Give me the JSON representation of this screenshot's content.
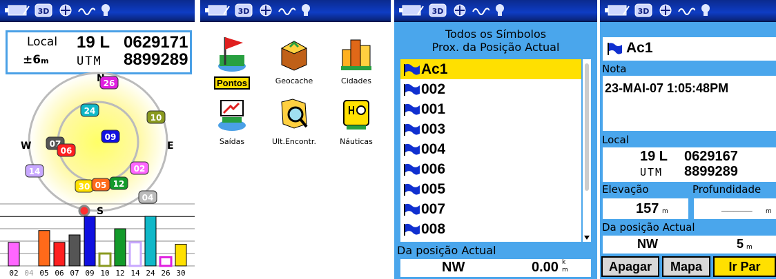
{
  "gps": {
    "location_label": "Local",
    "accuracy_value": "±6",
    "accuracy_unit": "m",
    "utm_label": "UTM",
    "zone": "19 L",
    "easting": "0629171",
    "northing": "8899289",
    "compass": {
      "n": "N",
      "s": "S",
      "e": "E",
      "w": "W"
    },
    "satellites_sky": [
      "26",
      "24",
      "10",
      "09",
      "07",
      "06",
      "14",
      "02",
      "30",
      "05",
      "12",
      "04"
    ],
    "signal_bars": [
      {
        "id": "02",
        "level": 0.38,
        "color": "#ff66ff",
        "filled": true
      },
      {
        "id": "04",
        "level": 0.0,
        "color": "#bbbbbb",
        "filled": false
      },
      {
        "id": "05",
        "level": 0.57,
        "color": "#ff6a1a",
        "filled": true
      },
      {
        "id": "06",
        "level": 0.38,
        "color": "#ff2020",
        "filled": true
      },
      {
        "id": "07",
        "level": 0.5,
        "color": "#555555",
        "filled": true
      },
      {
        "id": "09",
        "level": 0.8,
        "color": "#1010e0",
        "filled": true
      },
      {
        "id": "10",
        "level": 0.2,
        "color": "#8a9a20",
        "filled": false
      },
      {
        "id": "12",
        "level": 0.6,
        "color": "#139a2a",
        "filled": true
      },
      {
        "id": "14",
        "level": 0.38,
        "color": "#c8a8ff",
        "filled": false
      },
      {
        "id": "24",
        "level": 0.8,
        "color": "#10b8c8",
        "filled": true
      },
      {
        "id": "26",
        "level": 0.14,
        "color": "#e020e0",
        "filled": false
      },
      {
        "id": "30",
        "level": 0.35,
        "color": "#ffe000",
        "filled": true
      }
    ]
  },
  "menu": {
    "items": [
      {
        "label": "Pontos",
        "icon": "flag-icon"
      },
      {
        "label": "Geocache",
        "icon": "treasure-chest-icon"
      },
      {
        "label": "Cidades",
        "icon": "city-icon"
      },
      {
        "label": "Saídas",
        "icon": "exit-icon"
      },
      {
        "label": "Ult.Encontr.",
        "icon": "magnifier-map-icon"
      },
      {
        "label": "Náuticas",
        "icon": "nautical-icon"
      }
    ]
  },
  "list": {
    "title_line1": "Todos os Símbolos",
    "title_line2": "Prox. da Posição Actual",
    "waypoints": [
      "Ac1",
      "002",
      "001",
      "003",
      "004",
      "006",
      "005",
      "007",
      "008"
    ],
    "footer_label": "Da posição Actual",
    "bearing": "NW",
    "distance": "0.00",
    "distance_unit_top": "k",
    "distance_unit_bottom": "m"
  },
  "detail": {
    "name": "Ac1",
    "note_label": "Nota",
    "note_text": "23-MAI-07 1:05:48PM",
    "location_label": "Local",
    "zone": "19 L",
    "easting": "0629167",
    "utm_label": "UTM",
    "northing": "8899289",
    "elevation_label": "Elevação",
    "depth_label": "Profundidade",
    "elevation_value": "157",
    "elevation_unit": "m",
    "depth_value": "_____",
    "depth_unit": "m",
    "from_label": "Da posição Actual",
    "bearing": "NW",
    "distance": "5",
    "distance_unit": "m",
    "buttons": {
      "delete": "Apagar",
      "map": "Mapa",
      "goto": "Ir Par"
    }
  }
}
